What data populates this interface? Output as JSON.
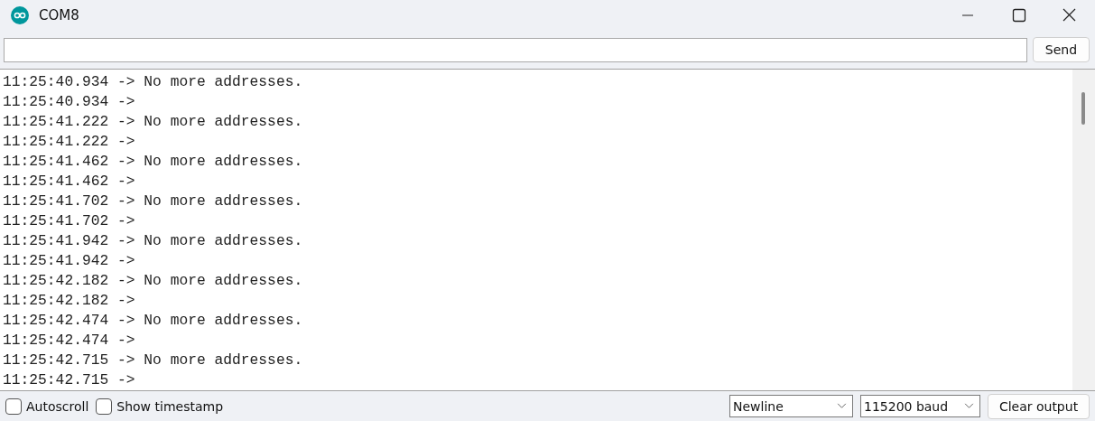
{
  "window": {
    "title": "COM8"
  },
  "send_button": "Send",
  "output_lines": [
    "11:25:40.934 -> No more addresses.",
    "11:25:40.934 -> ",
    "11:25:41.222 -> No more addresses.",
    "11:25:41.222 -> ",
    "11:25:41.462 -> No more addresses.",
    "11:25:41.462 -> ",
    "11:25:41.702 -> No more addresses.",
    "11:25:41.702 -> ",
    "11:25:41.942 -> No more addresses.",
    "11:25:41.942 -> ",
    "11:25:42.182 -> No more addresses.",
    "11:25:42.182 -> ",
    "11:25:42.474 -> No more addresses.",
    "11:25:42.474 -> ",
    "11:25:42.715 -> No more addresses.",
    "11:25:42.715 -> "
  ],
  "options": [
    {
      "label": "Autoscroll",
      "checked": false
    },
    {
      "label": "Show timestamp",
      "checked": false
    }
  ],
  "line_ending": "Newline",
  "baud_rate": "115200 baud",
  "clear_button": "Clear output"
}
